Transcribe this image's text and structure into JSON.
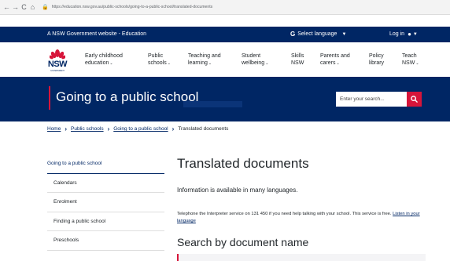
{
  "browser": {
    "back": "←",
    "forward": "→",
    "reload": "C",
    "home": "⌂",
    "url": "https://education.nsw.gov.au/public-schools/going-to-a-public-school/translated-documents"
  },
  "gov_bar": {
    "text": "A NSW Government website - Education",
    "language_label": "Select language",
    "login_label": "Log in"
  },
  "logo": {
    "text": "NSW",
    "subtext": "GOVERNMENT"
  },
  "nav": {
    "items": [
      {
        "line1": "Early childhood",
        "line2": "education"
      },
      {
        "line1": "Public",
        "line2": "schools"
      },
      {
        "line1": "Teaching and",
        "line2": "learning"
      },
      {
        "line1": "Student",
        "line2": "wellbeing"
      },
      {
        "line1": "Skills",
        "line2": "NSW"
      },
      {
        "line1": "Parents and",
        "line2": "carers"
      },
      {
        "line1": "Policy",
        "line2": "library"
      },
      {
        "line1": "Teach",
        "line2": "NSW"
      }
    ]
  },
  "banner": {
    "title": "Going to a public school"
  },
  "search": {
    "placeholder": "Enter your search..."
  },
  "breadcrumb": {
    "home": "Home",
    "public_schools": "Public schools",
    "going": "Going to a public school",
    "current": "Translated documents"
  },
  "sidebar": {
    "items": [
      {
        "label": "Going to a public school"
      },
      {
        "label": "Calendars"
      },
      {
        "label": "Enrolment"
      },
      {
        "label": "Finding a public school"
      },
      {
        "label": "Preschools"
      }
    ]
  },
  "main": {
    "title": "Translated documents",
    "intro": "Information is available in many languages.",
    "phone_text": "Telephone the Interpreter service on 131 450 if you need help talking with your school. This service is free.",
    "listen_link": "Listen in your language",
    "section_title": "Search by document name"
  },
  "colors": {
    "navy": "#002664",
    "red": "#d7153a"
  }
}
